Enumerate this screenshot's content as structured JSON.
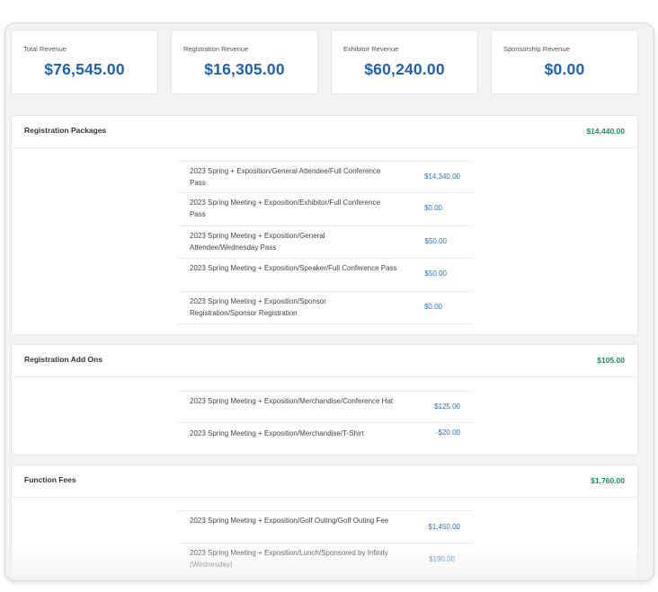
{
  "summary": [
    {
      "label": "Total Revenue",
      "value": "$76,545.00"
    },
    {
      "label": "Registration Revenue",
      "value": "$16,305.00"
    },
    {
      "label": "Exhibitor Revenue",
      "value": "$60,240.00"
    },
    {
      "label": "Sponsorship Revenue",
      "value": "$0.00"
    }
  ],
  "sections": [
    {
      "title": "Registration Packages",
      "total": "$14,440.00",
      "items": [
        {
          "name": "2023 Spring + Exposition/General Attendee/Full Conference Pass",
          "amount": "$14,340.00"
        },
        {
          "name": "2023 Spring Meeting + Exposition/Exhibitor/Full Conference Pass",
          "amount": "$0.00"
        },
        {
          "name": "2023 Spring Meeting + Exposition/General Attendee/Wednesday Pass",
          "amount": "$50.00"
        },
        {
          "name": "2023 Spring Meeting + Exposition/Speaker/Full Conference Pass",
          "amount": "$50.00"
        },
        {
          "name": "2023 Spring Meeting + Exposition/Sponsor Registration/Sponsor Registration",
          "amount": "$0.00"
        }
      ]
    },
    {
      "title": "Registration Add Ons",
      "total": "$105.00",
      "items": [
        {
          "name": "2023 Spring Meeting + Exposition/Merchandise/Conference Hat",
          "amount": "$125.00"
        },
        {
          "name": "2023 Spring Meeting + Exposition/Merchandise/T-Shirt",
          "amount": "-$20.00"
        }
      ]
    },
    {
      "title": "Function Fees",
      "total": "$1,760.00",
      "items": [
        {
          "name": "2023 Spring Meeting + Exposition/Golf Outing/Golf Outing Fee",
          "amount": "$1,450.00"
        },
        {
          "name": "2023 Spring Meeting + Exposition/Lunch/Sponsored by Infinity (Wednesday)",
          "amount": "$190.00"
        }
      ]
    }
  ],
  "colors": {
    "accent_blue": "#1f62b5",
    "total_green": "#16925d",
    "amount_blue": "#2f6fc0"
  }
}
